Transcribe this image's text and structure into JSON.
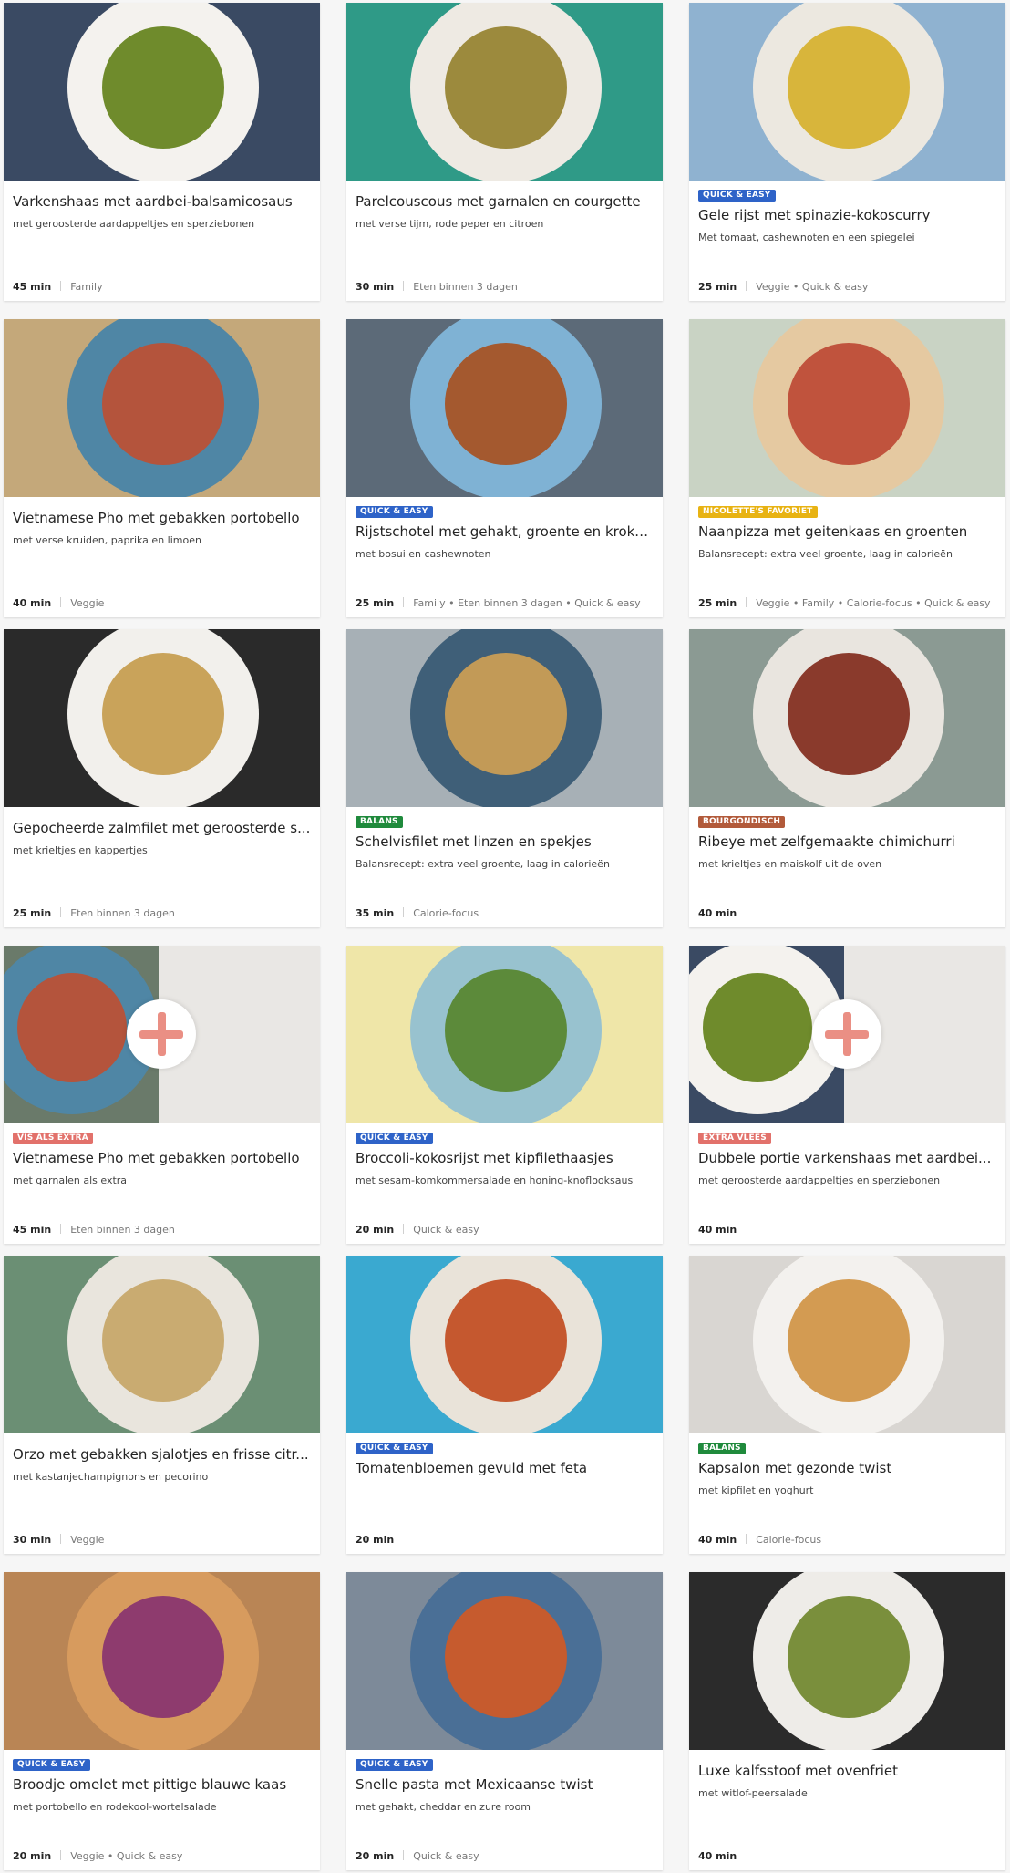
{
  "recipes": [
    {
      "image_icon": "recipe-photo-pork-beans",
      "tag": "",
      "title": "Varkenshaas met aardbei-balsamicosaus",
      "subtitle": "met geroosterde aardappeltjes en sperziebonen",
      "time": "45 min",
      "labels": "Family",
      "img_bg": "#3a4a63",
      "plate": "#f4f2ee",
      "food": "#6f8b2c",
      "combo": false
    },
    {
      "image_icon": "recipe-photo-couscous",
      "tag": "",
      "title": "Parelcouscous met garnalen en courgette",
      "subtitle": "met verse tijm, rode peper en citroen",
      "time": "30 min",
      "labels": "Eten binnen 3 dagen",
      "img_bg": "#2f9a87",
      "plate": "#eeeae3",
      "food": "#9c8a3d",
      "combo": false
    },
    {
      "image_icon": "recipe-photo-rice-egg",
      "tag": "QUICK & EASY",
      "tag_color": "#2e63c8",
      "title": "Gele rijst met spinazie-kokoscurry",
      "subtitle": "Met tomaat, cashewnoten en een spiegelei",
      "time": "25 min",
      "labels": "Veggie • Quick & easy",
      "img_bg": "#8fb2d0",
      "plate": "#ece8e0",
      "food": "#d8b53b",
      "combo": false
    },
    {
      "image_icon": "recipe-photo-pho",
      "tag": "",
      "title": "Vietnamese Pho met gebakken portobello",
      "subtitle": "met verse kruiden, paprika en limoen",
      "time": "40 min",
      "labels": "Veggie",
      "img_bg": "#c4a87a",
      "plate": "#4f86a5",
      "food": "#b4543c",
      "combo": false
    },
    {
      "image_icon": "recipe-photo-rice-casserole",
      "tag": "QUICK & EASY",
      "tag_color": "#2e63c8",
      "title": "Rijstschotel met gehakt, groente en kroka...",
      "subtitle": "met bosui en cashewnoten",
      "time": "25 min",
      "labels": "Family • Eten binnen 3 dagen • Quick & easy",
      "img_bg": "#5c6a78",
      "plate": "#7fb2d4",
      "food": "#a4592f",
      "combo": false
    },
    {
      "image_icon": "recipe-photo-naan-pizza",
      "tag": "NICOLETTE'S FAVORIET",
      "tag_color": "#e8b313",
      "title": "Naanpizza met geitenkaas en groenten",
      "subtitle": "Balansrecept: extra veel groente, laag in calorieën",
      "time": "25 min",
      "labels": "Veggie • Family • Calorie-focus • Quick & easy",
      "img_bg": "#c9d3c4",
      "plate": "#e5c9a1",
      "food": "#c0533d",
      "combo": false
    },
    {
      "image_icon": "recipe-photo-salmon",
      "tag": "",
      "title": "Gepocheerde zalmfilet met geroosterde s...",
      "subtitle": "met krieltjes en kappertjes",
      "time": "25 min",
      "labels": "Eten binnen 3 dagen",
      "img_bg": "#2a2a2a",
      "plate": "#f2f0ec",
      "food": "#c9a35a",
      "combo": false
    },
    {
      "image_icon": "recipe-photo-haddock",
      "tag": "BALANS",
      "tag_color": "#1f8a3c",
      "title": "Schelvisfilet met linzen en spekjes",
      "subtitle": "Balansrecept: extra veel groente, laag in calorieën",
      "time": "35 min",
      "labels": "Calorie-focus",
      "img_bg": "#a7b0b6",
      "plate": "#3f5f78",
      "food": "#c29a57",
      "combo": false
    },
    {
      "image_icon": "recipe-photo-ribeye",
      "tag": "BOURGONDISCH",
      "tag_color": "#b25a3a",
      "title": "Ribeye met zelfgemaakte chimichurri",
      "subtitle": "met krieltjes en maiskolf uit de oven",
      "time": "40 min",
      "labels": "",
      "img_bg": "#8b9a93",
      "plate": "#e9e5df",
      "food": "#8a3a2c",
      "combo": false
    },
    {
      "image_icon": "recipe-photo-pho-shrimp",
      "tag": "VIS ALS EXTRA",
      "tag_color": "#e2716b",
      "title": "Vietnamese Pho met gebakken portobello",
      "subtitle": "met garnalen als extra",
      "time": "45 min",
      "labels": "Eten binnen 3 dagen",
      "img_bg": "#6a7a6a",
      "plate": "#4f86a5",
      "food": "#b4543c",
      "combo": true
    },
    {
      "image_icon": "recipe-photo-broccoli-rice",
      "tag": "QUICK & EASY",
      "tag_color": "#2e63c8",
      "title": "Broccoli-kokosrijst met kipfilethaasjes",
      "subtitle": "met sesam-komkommersalade en honing-knoflooksaus",
      "time": "20 min",
      "labels": "Quick & easy",
      "img_bg": "#efe6a8",
      "plate": "#98c2cf",
      "food": "#5c8a3a",
      "combo": false
    },
    {
      "image_icon": "recipe-photo-pork-double",
      "tag": "EXTRA VLEES",
      "tag_color": "#e2716b",
      "title": "Dubbele portie varkenshaas met aardbei...",
      "subtitle": "met geroosterde aardappeltjes en sperziebonen",
      "time": "40 min",
      "labels": "",
      "img_bg": "#3a4a63",
      "plate": "#f4f2ee",
      "food": "#6f8b2c",
      "combo": true
    },
    {
      "image_icon": "recipe-photo-orzo",
      "tag": "",
      "title": "Orzo met gebakken sjalotjes en frisse citr...",
      "subtitle": "met kastanjechampignons en pecorino",
      "time": "30 min",
      "labels": "Veggie",
      "img_bg": "#6b8f74",
      "plate": "#e9e5dd",
      "food": "#c9ab71",
      "combo": false
    },
    {
      "image_icon": "recipe-photo-tomatoes",
      "tag": "QUICK & EASY",
      "tag_color": "#2e63c8",
      "title": "Tomatenbloemen gevuld met feta",
      "subtitle": "",
      "time": "20 min",
      "labels": "",
      "img_bg": "#3aa9d0",
      "plate": "#e9e3d9",
      "food": "#c5582f",
      "combo": false
    },
    {
      "image_icon": "recipe-photo-kapsalon",
      "tag": "BALANS",
      "tag_color": "#1f8a3c",
      "title": "Kapsalon met gezonde twist",
      "subtitle": "met kipfilet en yoghurt",
      "time": "40 min",
      "labels": "Calorie-focus",
      "img_bg": "#d9d6d2",
      "plate": "#f3f1ee",
      "food": "#d39b52",
      "combo": false
    },
    {
      "image_icon": "recipe-photo-sandwich",
      "tag": "QUICK & EASY",
      "tag_color": "#2e63c8",
      "title": "Broodje omelet met pittige blauwe kaas",
      "subtitle": "met portobello en rodekool-wortelsalade",
      "time": "20 min",
      "labels": "Veggie • Quick & easy",
      "img_bg": "#b98555",
      "plate": "#d79b5e",
      "food": "#8e3b6e",
      "combo": false
    },
    {
      "image_icon": "recipe-photo-pasta",
      "tag": "QUICK & EASY",
      "tag_color": "#2e63c8",
      "title": "Snelle pasta met Mexicaanse twist",
      "subtitle": "met gehakt, cheddar en zure room",
      "time": "20 min",
      "labels": "Quick & easy",
      "img_bg": "#7d8a99",
      "plate": "#4a6f96",
      "food": "#c65b2e",
      "combo": false
    },
    {
      "image_icon": "recipe-photo-veal-stew",
      "tag": "",
      "title": "Luxe kalfsstoof met ovenfriet",
      "subtitle": "met witlof-peersalade",
      "time": "40 min",
      "labels": "",
      "img_bg": "#2b2b2b",
      "plate": "#eeece8",
      "food": "#7a8f3c",
      "combo": false
    }
  ]
}
